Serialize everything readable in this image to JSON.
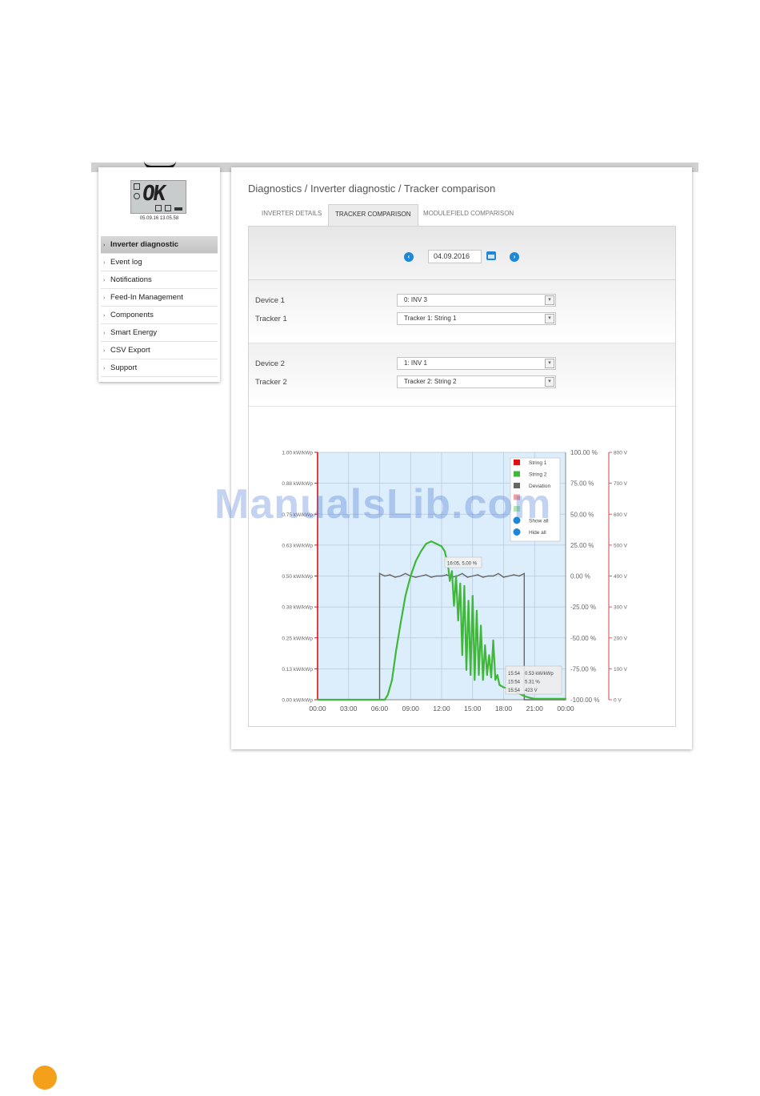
{
  "device": {
    "display_text": "OK",
    "timestamp": "05.09.16 13.05.58"
  },
  "sidebar": {
    "items": [
      {
        "label": "Inverter diagnostic",
        "active": true
      },
      {
        "label": "Event log"
      },
      {
        "label": "Notifications"
      },
      {
        "label": "Feed-In Management"
      },
      {
        "label": "Components"
      },
      {
        "label": "Smart Energy"
      },
      {
        "label": "CSV Export"
      },
      {
        "label": "Support"
      }
    ]
  },
  "main": {
    "breadcrumb": "Diagnostics / Inverter diagnostic / Tracker comparison",
    "tabs": [
      {
        "label": "INVERTER DETAILS"
      },
      {
        "label": "TRACKER COMPARISON",
        "active": true
      },
      {
        "label": "MODULEFIELD COMPARISON"
      }
    ],
    "date": "04.09.2016",
    "device1_label": "Device 1",
    "device1_value": "0: INV 3",
    "tracker1_label": "Tracker 1",
    "tracker1_value": "Tracker 1: String 1",
    "device2_label": "Device 2",
    "device2_value": "1: INV 1",
    "tracker2_label": "Tracker 2",
    "tracker2_value": "Tracker 2: String 2"
  },
  "chart_data": {
    "type": "line",
    "x_ticks": [
      "00:00",
      "03:00",
      "06:00",
      "09:00",
      "12:00",
      "15:00",
      "18:00",
      "21:00",
      "00:00"
    ],
    "x_range_hours": [
      0,
      24
    ],
    "y_left_ticks": [
      "1.00 kW/kWp",
      "0.88 kW/kWp",
      "0.75 kW/kWp",
      "0.63 kW/kWp",
      "0.50 kW/kWp",
      "0.38 kW/kWp",
      "0.25 kW/kWp",
      "0.13 kW/kWp",
      "0.00 kW/kWp"
    ],
    "y_mid_ticks": [
      "100.00 %",
      "75.00 %",
      "50.00 %",
      "25.00 %",
      "0.00 %",
      "-25.00 %",
      "-50.00 %",
      "-75.00 %",
      "-100.00 %"
    ],
    "y_right_ticks": [
      "800 V",
      "700 V",
      "600 V",
      "500 V",
      "400 V",
      "300 V",
      "200 V",
      "100 V",
      "0 V"
    ],
    "ylim_left": [
      0,
      1
    ],
    "ylim_mid": [
      -100,
      100
    ],
    "legend": [
      "String 1",
      "String 2",
      "Deviation",
      "",
      "",
      "Show all",
      "Hide all"
    ],
    "legend_position": "top-right",
    "grid": true,
    "colors": {
      "string1": "#dd1111",
      "string2": "#3fb83a",
      "deviation": "#666666",
      "plot_bg": "#dcedfb",
      "left_axis": "#dd1111",
      "right_axis": "#e06060"
    },
    "series": [
      {
        "name": "String 2",
        "x": [
          0,
          6.5,
          6.8,
          7.2,
          7.6,
          8.0,
          8.5,
          9.0,
          9.5,
          10.0,
          10.5,
          11.0,
          11.5,
          12.0,
          12.3,
          12.6,
          12.8,
          13.0,
          13.2,
          13.4,
          13.6,
          13.8,
          14.0,
          14.2,
          14.4,
          14.6,
          14.8,
          15.0,
          15.2,
          15.4,
          15.6,
          15.8,
          16.0,
          16.2,
          16.4,
          16.6,
          16.8,
          17.0,
          17.2,
          17.4,
          17.6,
          18.0,
          18.5,
          19.0,
          19.5,
          20.0,
          20.5,
          21.0,
          24
        ],
        "y": [
          0,
          0,
          0.02,
          0.08,
          0.2,
          0.3,
          0.42,
          0.5,
          0.56,
          0.6,
          0.63,
          0.64,
          0.63,
          0.62,
          0.6,
          0.55,
          0.48,
          0.52,
          0.38,
          0.5,
          0.32,
          0.47,
          0.18,
          0.46,
          0.12,
          0.4,
          0.1,
          0.42,
          0.08,
          0.36,
          0.1,
          0.3,
          0.08,
          0.22,
          0.1,
          0.18,
          0.09,
          0.24,
          0.08,
          0.1,
          0.06,
          0.05,
          0.045,
          0.035,
          0.025,
          0.015,
          0.008,
          0.004,
          0.004
        ]
      },
      {
        "name": "Deviation",
        "x": [
          0,
          6.0,
          6.0,
          6.5,
          7.0,
          7.5,
          8.0,
          8.5,
          9.0,
          9.5,
          10.0,
          10.5,
          11.0,
          11.5,
          12.0,
          12.5,
          13.0,
          13.5,
          14.0,
          14.5,
          15.0,
          15.5,
          16.0,
          16.5,
          17.0,
          17.5,
          18.0,
          18.5,
          19.0,
          19.5,
          20.0,
          20.0,
          24
        ],
        "y": [
          -100,
          -100,
          2,
          0,
          1,
          -1,
          0,
          2,
          0,
          -1,
          0,
          1,
          -1,
          0,
          0,
          1,
          -1,
          0,
          2,
          -1,
          0,
          1,
          -1,
          0,
          0,
          2,
          -1,
          0,
          1,
          0,
          2,
          -100,
          -100
        ]
      }
    ],
    "tooltips": [
      {
        "text": "16:05, 5.00 %"
      },
      {
        "lines": [
          "15:54",
          "0.53 kW/kWp",
          "15:54",
          "5.31 %",
          "15:54",
          "423 V"
        ]
      }
    ]
  },
  "watermark": "ManualsLib.com"
}
